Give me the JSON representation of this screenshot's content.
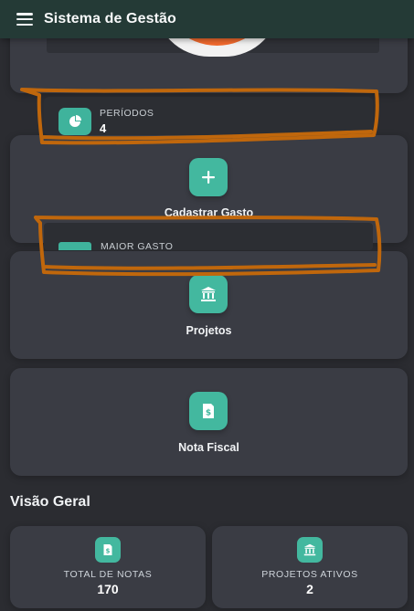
{
  "header": {
    "title": "Sistema de Gestão"
  },
  "stats_preview": {
    "periodos_label": "PERÍODOS",
    "periodos_value": "4",
    "maior_gasto_label": "MAIOR GASTO"
  },
  "actions": [
    {
      "label": "Cadastrar Gasto",
      "icon": "plus-icon"
    },
    {
      "label": "Projetos",
      "icon": "bank-icon"
    },
    {
      "label": "Nota Fiscal",
      "icon": "invoice-icon"
    }
  ],
  "overview": {
    "title": "Visão Geral",
    "cards": [
      {
        "label": "TOTAL DE NOTAS",
        "value": "170",
        "icon": "invoice-icon"
      },
      {
        "label": "PROJETOS ATIVOS",
        "value": "2",
        "icon": "bank-icon"
      }
    ]
  },
  "colors": {
    "accent": "#43b89f",
    "header_bg": "#243a36",
    "page_bg": "#2b2c31",
    "card_bg": "#3a3c44",
    "orange": "#f26a2e",
    "annotation": "#c0670c"
  }
}
